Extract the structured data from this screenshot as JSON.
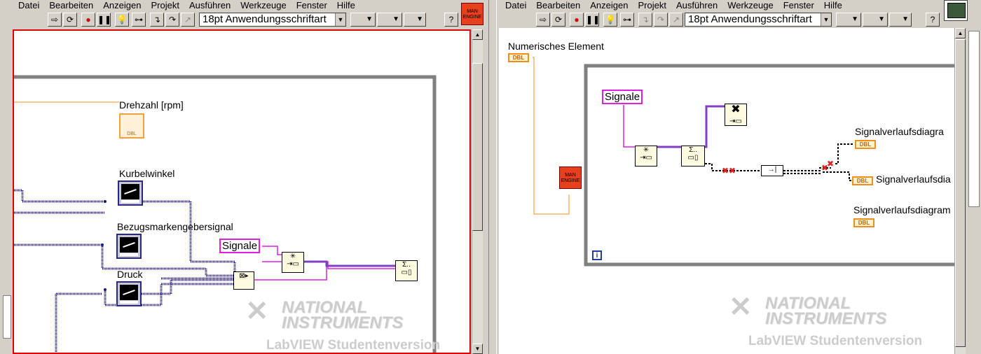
{
  "left": {
    "menu": [
      "Datei",
      "Bearbeiten",
      "Anzeigen",
      "Projekt",
      "Ausführen",
      "Werkzeuge",
      "Fenster",
      "Hilfe"
    ],
    "font_select": "18pt Anwendungsschriftart",
    "help_button": "?",
    "engine_icon": "MAN ENGINE",
    "labels": {
      "drehzahl": "Drehzahl [rpm]",
      "kurbelwinkel": "Kurbelwinkel",
      "bezugsmarken": "Bezugsmarkengebersignal",
      "druck": "Druck",
      "signale": "Signale"
    },
    "dbl_tag": "DBL"
  },
  "right": {
    "menu": [
      "Datei",
      "Bearbeiten",
      "Anzeigen",
      "Projekt",
      "Ausführen",
      "Werkzeuge",
      "Fenster",
      "Hilfe"
    ],
    "font_select": "18pt Anwendungsschriftart",
    "help_button": "?",
    "engine_icon": "MAN ENGINE",
    "labels": {
      "numerisches": "Numerisches Element",
      "signale": "Signale",
      "sv1": "Signalverlaufsdiagra",
      "sv2": "Signalverlaufsdia",
      "sv3": "Signalverlaufsdiagram"
    },
    "dbl_tag": "DBL",
    "iteration": "i"
  },
  "watermark": {
    "line1": "NATIONAL",
    "line2": "INSTRUMENTS",
    "line3": "LabVIEW Studentenversion"
  },
  "colors": {
    "wire_orange": "#e8901c",
    "wire_blue": "#1a1a7a",
    "wire_pink": "#e020e0",
    "loop_gray": "#808080",
    "canvas_border_red": "#e00000"
  }
}
